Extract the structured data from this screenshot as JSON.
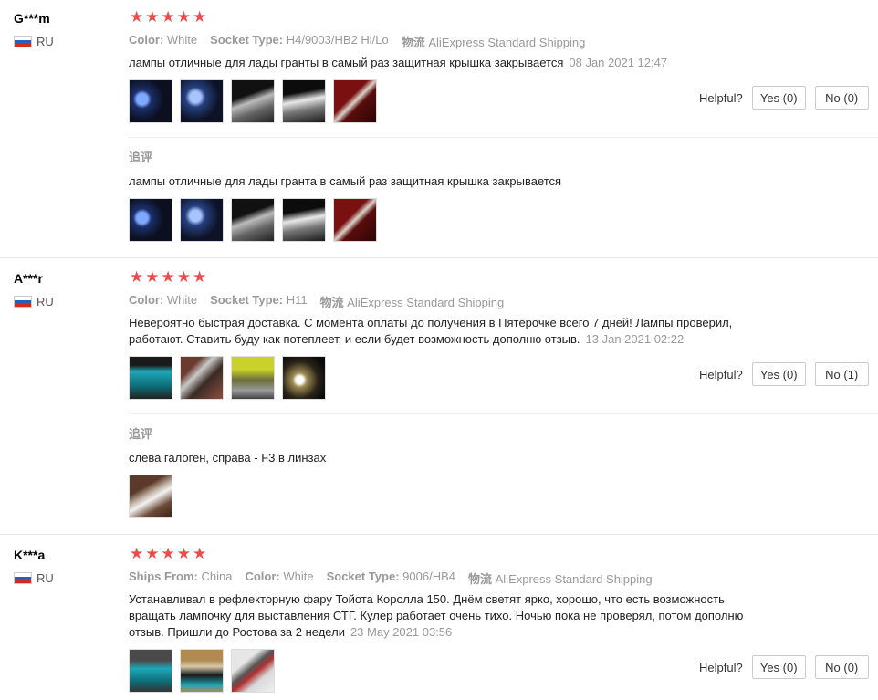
{
  "labels": {
    "color": "Color:",
    "socket_type": "Socket Type:",
    "shipping": "物流",
    "ships_from": "Ships From:",
    "helpful": "Helpful?",
    "followup": "追评"
  },
  "reviews": [
    {
      "user": "G***m",
      "country": "RU",
      "stars": 5,
      "color": "White",
      "socket_type": "H4/9003/HB2 Hi/Lo",
      "shipping": "AliExpress Standard Shipping",
      "text": "лампы отличные для лады гранты в самый раз защитная крышка закрывается",
      "date": "08 Jan 2021 12:47",
      "yes": "Yes (0)",
      "no": "No (0)",
      "followup_text": "лампы отличные для лады гранта в самый раз защитная крышка закрывается"
    },
    {
      "user": "A***r",
      "country": "RU",
      "stars": 5,
      "color": "White",
      "socket_type": "H11",
      "shipping": "AliExpress Standard Shipping",
      "text_line1": "Невероятно быстрая доставка. С момента оплаты до получения в Пятёрочке всего 7 дней! Лампы проверил,",
      "text_line2": "работают. Ставить буду как потеплеет, и если будет возможность дополню отзыв.",
      "date": "13 Jan 2021 02:22",
      "yes": "Yes (0)",
      "no": "No (1)",
      "followup_text": "слева галоген, справа - F3 в линзах"
    },
    {
      "user": "K***a",
      "country": "RU",
      "stars": 5,
      "ships_from": "China",
      "color": "White",
      "socket_type": "9006/HB4",
      "shipping": "AliExpress Standard Shipping",
      "text_line1": "Устанавливал в рефлекторную фару Тойота Королла 150. Днём светят ярко, хорошо, что есть возможность",
      "text_line2": "вращать лампочку для выставления СТГ. Кулер работает очень тихо. Ночью пока не проверял, потом дополню",
      "text_line3": "отзыв. Пришли до Ростова за 2 недели",
      "date": "23 May 2021 03:56",
      "yes": "Yes (0)",
      "no": "No (0)"
    }
  ],
  "colors": {
    "star": "#ef4b4b",
    "muted": "#999999",
    "border": "#cccccc"
  }
}
